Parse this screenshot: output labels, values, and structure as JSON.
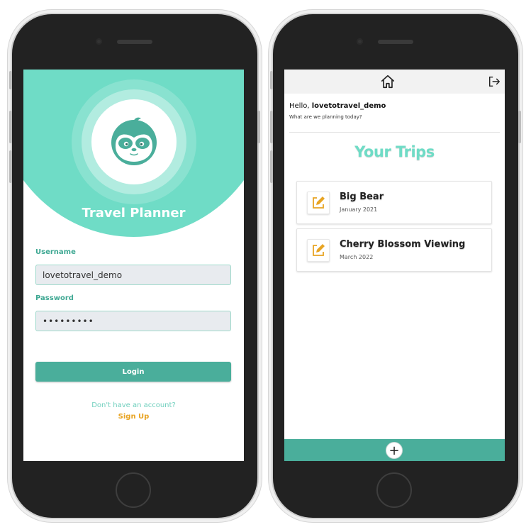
{
  "login": {
    "app_title": "Travel Planner",
    "username_label": "Username",
    "username_value": "lovetotravel_demo",
    "password_label": "Password",
    "password_value": "•••••••••",
    "login_button": "Login",
    "signup_hint": "Don't have an account?",
    "signup_link": "Sign Up"
  },
  "home": {
    "greeting_prefix": "Hello, ",
    "username": "lovetotravel_demo",
    "subtitle": "What are we planning today?",
    "section_title": "Your Trips",
    "trips": [
      {
        "name": "Big Bear",
        "date": "January 2021"
      },
      {
        "name": "Cherry Blossom Viewing",
        "date": "March 2022"
      }
    ],
    "add_button": "+"
  },
  "icons": {
    "logo": "sloth-logo-icon",
    "home": "home-icon",
    "logout": "logout-icon",
    "edit": "edit-icon"
  },
  "colors": {
    "mint": "#6fdcc6",
    "teal": "#4aae9b",
    "accent_orange": "#e8a423"
  }
}
